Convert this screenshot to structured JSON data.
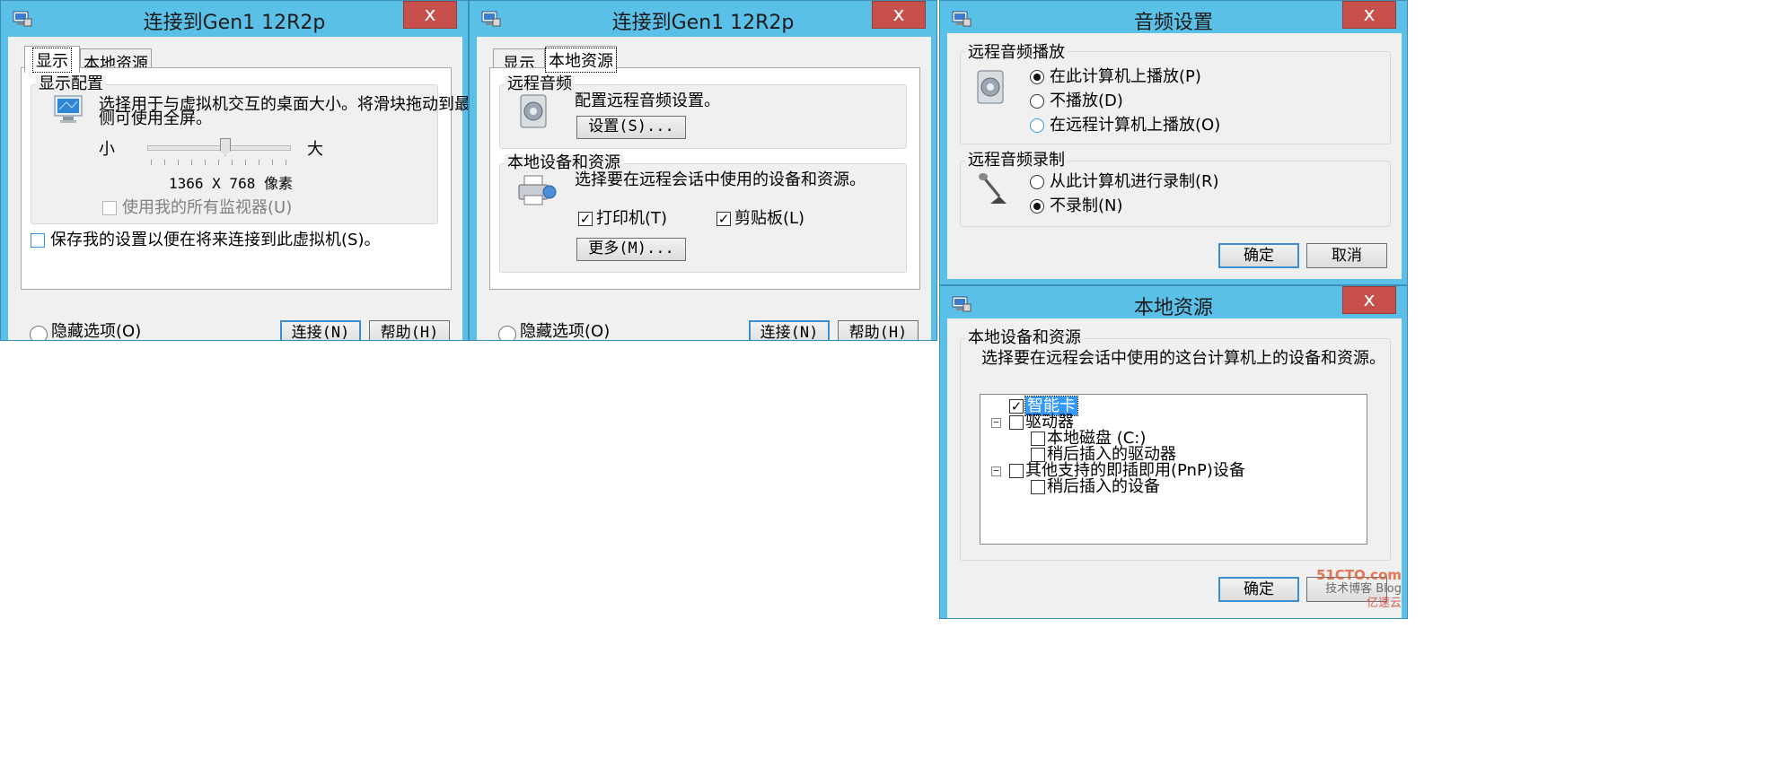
{
  "colors": {
    "frame": "#5bc0e8",
    "close": "#c7504b",
    "client": "#f0f0f0",
    "selection": "#3399ff"
  },
  "win1": {
    "title": "连接到Gen1 12R2p",
    "close_glyph": "x",
    "tab_display": "显示",
    "tab_local": "本地资源",
    "group_label": "显示配置",
    "desc_line1": "选择用于与虚拟机交互的桌面大小。将滑块拖动到最右",
    "desc_line2": "侧可使用全屏。",
    "slider_min": "小",
    "slider_max": "大",
    "slider_level": 0.55,
    "resolution": "1366 X 768 像素",
    "use_all_monitors": "使用我的所有监视器(U)",
    "save_settings": "保存我的设置以便在将来连接到此虚拟机(S)。",
    "hide_options": "隐藏选项(O)",
    "connect_btn": "连接(N)",
    "help_btn": "帮助(H)"
  },
  "win2": {
    "title": "连接到Gen1 12R2p",
    "close_glyph": "x",
    "tab_display": "显示",
    "tab_local": "本地资源",
    "remote_audio_label": "远程音频",
    "remote_audio_desc": "配置远程音频设置。",
    "settings_btn": "设置(S)...",
    "local_devices_label": "本地设备和资源",
    "local_devices_desc": "选择要在远程会话中使用的设备和资源。",
    "printer": "打印机(T)",
    "clipboard": "剪贴板(L)",
    "more_btn": "更多(M)...",
    "hide_options": "隐藏选项(O)",
    "connect_btn": "连接(N)",
    "help_btn": "帮助(H)"
  },
  "win3": {
    "title": "音频设置",
    "close_glyph": "x",
    "playback_label": "远程音频播放",
    "play_here": "在此计算机上播放(P)",
    "no_play": "不播放(D)",
    "play_remote": "在远程计算机上播放(O)",
    "recording_label": "远程音频录制",
    "record_here": "从此计算机进行录制(R)",
    "no_record": "不录制(N)",
    "ok_btn": "确定",
    "cancel_btn": "取消"
  },
  "win4": {
    "title": "本地资源",
    "close_glyph": "x",
    "group_label": "本地设备和资源",
    "desc": "选择要在远程会话中使用的这台计算机上的设备和资源。",
    "tree": {
      "smart_card": "智能卡",
      "drives": "驱动器",
      "local_disk": "本地磁盘 (C:)",
      "later_drives": "稍后插入的驱动器",
      "pnp": "其他支持的即插即用(PnP)设备",
      "later_devices": "稍后插入的设备"
    },
    "ok_btn": "确定",
    "watermark_line1": "51CTO.com",
    "watermark_line2": "技术博客 Blog",
    "watermark_line3": "亿速云"
  }
}
